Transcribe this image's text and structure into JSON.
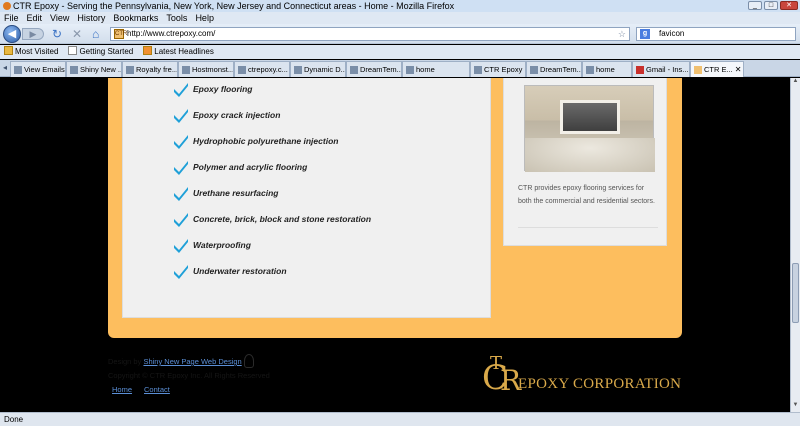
{
  "window": {
    "title": "CTR Epoxy - Serving the Pennsylvania, New York, New Jersey and Connecticut areas - Home - Mozilla Firefox"
  },
  "menu": [
    "File",
    "Edit",
    "View",
    "History",
    "Bookmarks",
    "Tools",
    "Help"
  ],
  "nav": {
    "url": "http://www.ctrepoxy.com/",
    "search_value": "favicon",
    "favicon_text": "CTR"
  },
  "bookmarks": [
    "Most Visited",
    "Getting Started",
    "Latest Headlines"
  ],
  "tabs": [
    "View Emails",
    "Shiny New ...",
    "Royalty fre...",
    "Hostmonst...",
    "ctrepoxy.c...",
    "Dynamic D...",
    "DreamTem...",
    "home",
    "CTR Epoxy ...",
    "DreamTem...",
    "home",
    "Gmail - Ins...",
    "CTR E..."
  ],
  "services": [
    "Epoxy flooring",
    "Epoxy crack injection",
    "Hydrophobic polyurethane injection",
    "Polymer and acrylic flooring",
    "Urethane resurfacing",
    "Concrete, brick, block and stone restoration",
    "Waterproofing",
    "Underwater restoration"
  ],
  "sidebar": {
    "text": "CTR provides epoxy flooring services for both the commercial and residential sectors."
  },
  "footer": {
    "design_prefix": "Design by",
    "design_link": "Shiny New Page Web Design",
    "copyright": "Copyright © CTR Epoxy Inc. All Rights Reserved",
    "links": [
      "Home",
      "Contact"
    ]
  },
  "logo": {
    "letters_c": "C",
    "letters_t": "T",
    "letters_r": "R",
    "name": "EPOXY CORPORATION"
  },
  "status": "Done",
  "colors": {
    "orange": "#fdbe5e",
    "check": "#1fa0d8",
    "logo": "#d9a94a",
    "link": "#5b8fd6"
  }
}
